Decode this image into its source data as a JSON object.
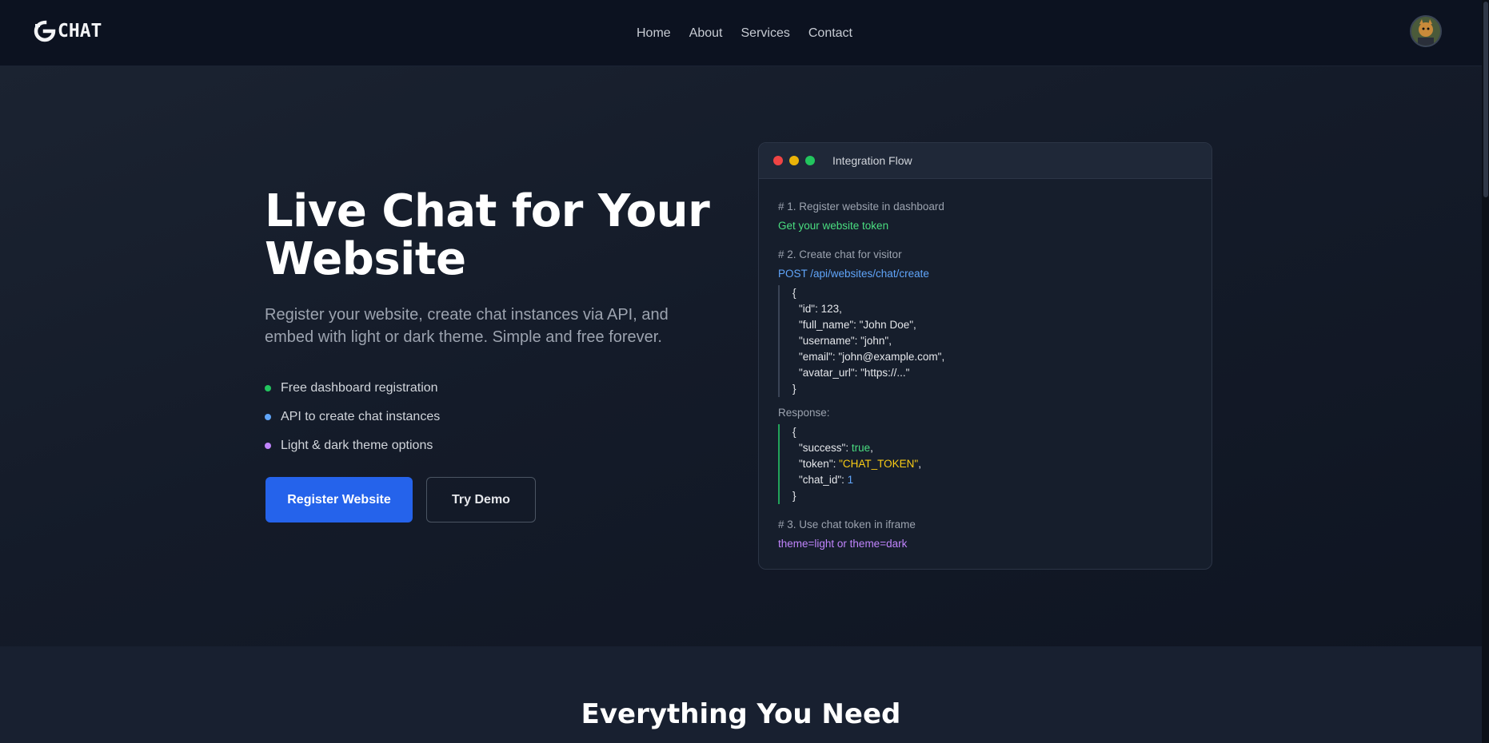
{
  "brand": {
    "name": "CHAT"
  },
  "nav": {
    "items": [
      "Home",
      "About",
      "Services",
      "Contact"
    ]
  },
  "hero": {
    "title": "Live Chat for Your Website",
    "subtitle": "Register your website, create chat instances via API, and embed with light or dark theme. Simple and free forever.",
    "features": [
      {
        "label": "Free dashboard registration",
        "color": "#22c55e"
      },
      {
        "label": "API to create chat instances",
        "color": "#60a5fa"
      },
      {
        "label": "Light & dark theme options",
        "color": "#c084fc"
      }
    ],
    "primary_button": "Register Website",
    "secondary_button": "Try Demo"
  },
  "card": {
    "title": "Integration Flow",
    "window_dots": [
      "#ef4444",
      "#eab308",
      "#22c55e"
    ],
    "step1_comment": "# 1. Register website in dashboard",
    "step1_action": "Get your website token",
    "step2_comment": "# 2. Create chat for visitor",
    "step2_action": "POST /api/websites/chat/create",
    "request": {
      "open": "{",
      "id": "\"id\": 123,",
      "full_name": "\"full_name\": \"John Doe\",",
      "username": "\"username\": \"john\",",
      "email": "\"email\": \"john@example.com\",",
      "avatar_url": "\"avatar_url\": \"https://...\"",
      "close": "}"
    },
    "response_label": "Response:",
    "response": {
      "open": "{",
      "success_key": "\"success\": ",
      "success_val": "true",
      "token_key": "\"token\": ",
      "token_val": "\"CHAT_TOKEN\"",
      "chat_id_key": "\"chat_id\": ",
      "chat_id_val": "1",
      "close": "}"
    },
    "step3_comment": "# 3. Use chat token in iframe",
    "step3_action": "theme=light or theme=dark"
  },
  "section2": {
    "title": "Everything You Need"
  },
  "accent": {
    "primary": "#2563eb"
  }
}
